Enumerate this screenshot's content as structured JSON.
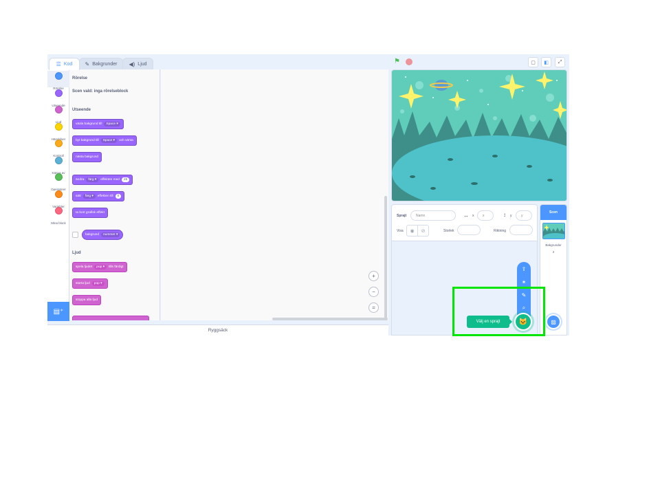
{
  "tabs": [
    {
      "label": "Kod",
      "icon": "code-icon"
    },
    {
      "label": "Bakgrunder",
      "icon": "brush-icon"
    },
    {
      "label": "Ljud",
      "icon": "speaker-icon"
    }
  ],
  "categories": [
    {
      "label": "Rörelse",
      "color": "#4c97ff"
    },
    {
      "label": "Utseende",
      "color": "#9966ff"
    },
    {
      "label": "Ljud",
      "color": "#cf63cf"
    },
    {
      "label": "Händelser",
      "color": "#ffd500"
    },
    {
      "label": "Kontroll",
      "color": "#ffab19"
    },
    {
      "label": "Känna av",
      "color": "#5cb1d6"
    },
    {
      "label": "Operatorer",
      "color": "#59c059"
    },
    {
      "label": "Variabler",
      "color": "#ff8c1a"
    },
    {
      "label": "Mina block",
      "color": "#ff6680"
    }
  ],
  "palette": {
    "motion_heading": "Rörelse",
    "motion_note": "Scen vald: inga rörelseblock",
    "looks_heading": "Utseende",
    "looks_blocks": [
      {
        "text": "växla bakgrund till",
        "dropdown": "Space ▾"
      },
      {
        "text": "byt bakgrund till",
        "dropdown": "Space ▾",
        "suffix": "och vänta"
      },
      {
        "text": "nästa bakgrund"
      },
      {
        "text": "ändra",
        "dropdown": "färg ▾",
        "suffix": "effekten med",
        "value": "25"
      },
      {
        "text": "sätt",
        "dropdown": "färg ▾",
        "suffix": "effekten till",
        "value": "0"
      },
      {
        "text": "ta bort grafisk effekt"
      },
      {
        "text": "bakgrund",
        "dropdown": "nummer ▾"
      }
    ],
    "sound_heading": "Ljud",
    "sound_blocks": [
      {
        "text": "spela ljudet",
        "dropdown": "pop ▾",
        "suffix": "tills färdigt"
      },
      {
        "text": "starta ljud",
        "dropdown": "pop ▾"
      },
      {
        "text": "stoppa alla ljud"
      }
    ]
  },
  "workspace": {
    "zoom_in": "+",
    "zoom_out": "−",
    "zoom_reset": "="
  },
  "backpack": "Ryggsäck",
  "sprite_info": {
    "sprite_label": "Sprajt",
    "name_placeholder": "Namn",
    "x_label": "x",
    "x_placeholder": "x",
    "y_label": "y",
    "y_placeholder": "y",
    "show_label": "Visa",
    "size_label": "Storlek",
    "direction_label": "Riktning"
  },
  "sprite_menu": {
    "tooltip": "Välj en sprajt"
  },
  "target_pane": {
    "scene_label": "Scen",
    "backdrops_label": "Bakgrunder",
    "backdrops_count": "2"
  }
}
